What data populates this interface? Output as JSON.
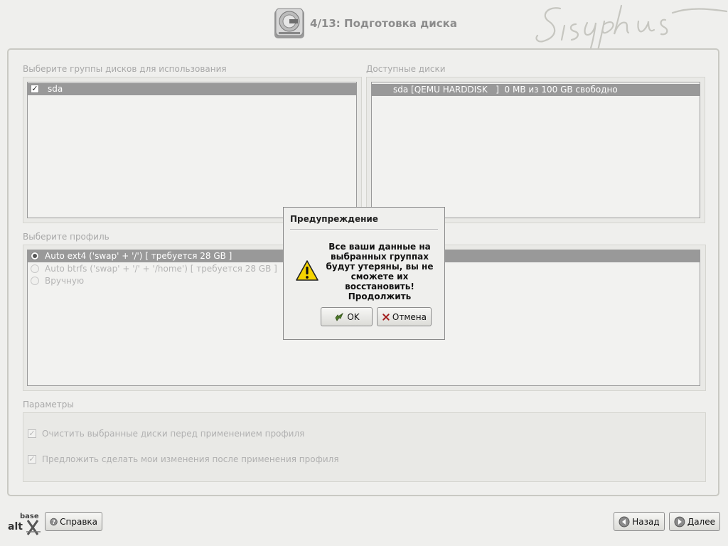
{
  "header": {
    "title": "4/13: Подготовка диска",
    "brand_signature": "Sisyphus"
  },
  "disk_groups": {
    "label": "Выберите группы дисков для использования",
    "items": [
      {
        "label": "sda",
        "checked": true
      }
    ]
  },
  "available_disks": {
    "label": "Доступные диски",
    "items": [
      {
        "label": "sda [QEMU HARDDISK   ]  0 MB из 100 GB свободно"
      }
    ]
  },
  "profile": {
    "label": "Выберите профиль",
    "options": [
      {
        "label": "Auto ext4 ('swap' + '/') [ требуется 28 GB ]",
        "selected": true
      },
      {
        "label": "Auto btrfs ('swap' + '/' + '/home') [ требуется 28 GB ]",
        "selected": false
      },
      {
        "label": "Вручную",
        "selected": false
      }
    ]
  },
  "params": {
    "label": "Параметры",
    "clean_disks": {
      "label": "Очистить выбранные диски перед применением профиля",
      "checked": true
    },
    "suggest_changes": {
      "label": "Предложить сделать мои изменения после применения профиля",
      "checked": true
    }
  },
  "dialog": {
    "title": "Предупреждение",
    "message": "Все ваши данные на выбранных группах будут утеряны, вы не сможете их восстановить! Продолжить",
    "ok_label": "OK",
    "cancel_label": "Отмена"
  },
  "footer": {
    "logo_text": "base alt",
    "help_label": "Справка",
    "back_label": "Назад",
    "next_label": "Далее"
  },
  "colors": {
    "selection": "#999999",
    "background": "#efefed",
    "warning": "#f5d400"
  }
}
